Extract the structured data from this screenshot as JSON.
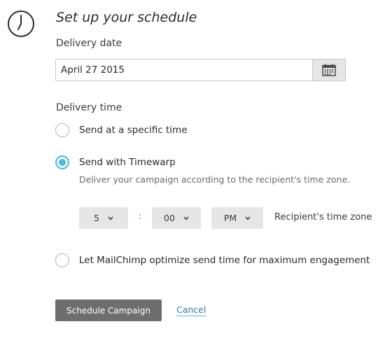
{
  "header": {
    "title": "Set up your schedule",
    "icon": "clock-icon"
  },
  "delivery_date": {
    "label": "Delivery date",
    "value": "April 27 2015",
    "picker_icon": "calendar-icon"
  },
  "delivery_time": {
    "label": "Delivery time",
    "options": [
      {
        "label": "Send at a specific time",
        "selected": false
      },
      {
        "label": "Send with Timewarp",
        "selected": true
      },
      {
        "label": "Let MailChimp optimize send time for maximum engagement",
        "selected": false
      }
    ],
    "timewarp_help": "Deliver your campaign according to the recipient's time zone.",
    "time": {
      "hour": "5",
      "separator": ":",
      "minute": "00",
      "period": "PM",
      "timezone_label": "Recipient's time zone"
    }
  },
  "actions": {
    "submit_label": "Schedule Campaign",
    "cancel_label": "Cancel"
  },
  "colors": {
    "accent": "#52bad5",
    "button": "#6e6e6e",
    "link": "#2c7aa8"
  }
}
